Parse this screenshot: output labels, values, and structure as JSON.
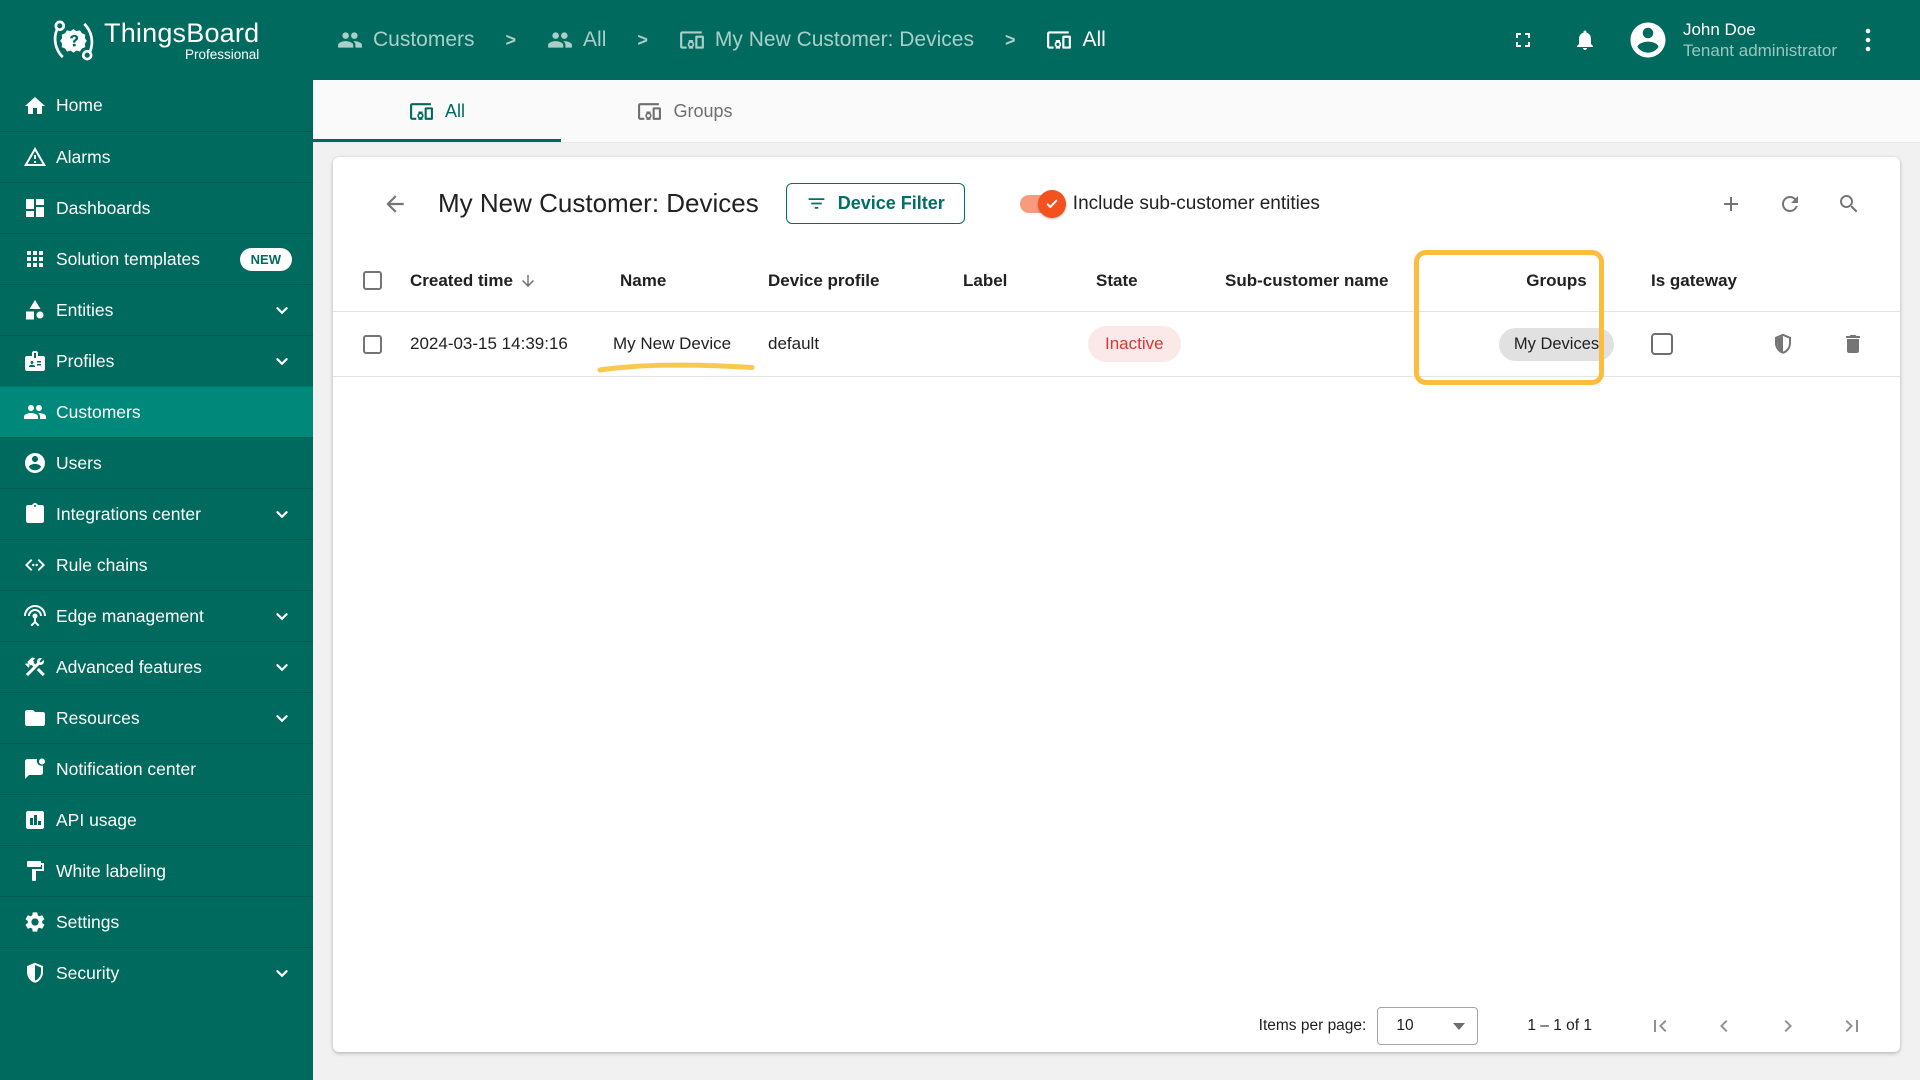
{
  "app": {
    "name": "ThingsBoard",
    "edition": "Professional"
  },
  "header": {
    "breadcrumb": [
      {
        "label": "Customers",
        "icon": "customers-icon"
      },
      {
        "label": "All",
        "icon": "customers-icon"
      },
      {
        "label": "My New Customer: Devices",
        "icon": "devices-icon"
      },
      {
        "label": "All",
        "icon": "devices-icon"
      }
    ],
    "icons": [
      "fullscreen-icon",
      "notifications-bell-icon",
      "avatar",
      "kebab-menu-icon"
    ],
    "user": {
      "name": "John Doe",
      "role": "Tenant administrator"
    }
  },
  "sidebar": {
    "items": [
      {
        "label": "Home",
        "icon": "home-icon"
      },
      {
        "label": "Alarms",
        "icon": "alarm-icon"
      },
      {
        "label": "Dashboards",
        "icon": "dashboards-icon"
      },
      {
        "label": "Solution templates",
        "icon": "solution-templates-icon",
        "badge": "NEW"
      },
      {
        "label": "Entities",
        "icon": "entities-icon",
        "expandable": true
      },
      {
        "label": "Profiles",
        "icon": "profiles-icon",
        "expandable": true
      },
      {
        "label": "Customers",
        "icon": "customers-icon",
        "active": true
      },
      {
        "label": "Users",
        "icon": "users-icon"
      },
      {
        "label": "Integrations center",
        "icon": "integrations-icon",
        "expandable": true
      },
      {
        "label": "Rule chains",
        "icon": "rule-chains-icon"
      },
      {
        "label": "Edge management",
        "icon": "edge-icon",
        "expandable": true
      },
      {
        "label": "Advanced features",
        "icon": "advanced-features-icon",
        "expandable": true
      },
      {
        "label": "Resources",
        "icon": "resources-icon",
        "expandable": true
      },
      {
        "label": "Notification center",
        "icon": "notification-icon"
      },
      {
        "label": "API usage",
        "icon": "api-usage-icon"
      },
      {
        "label": "White labeling",
        "icon": "white-labeling-icon"
      },
      {
        "label": "Settings",
        "icon": "settings-icon"
      },
      {
        "label": "Security",
        "icon": "security-icon",
        "expandable": true
      }
    ]
  },
  "tabs": [
    {
      "label": "All",
      "active": true
    },
    {
      "label": "Groups",
      "active": false
    }
  ],
  "toolbar": {
    "title": "My New Customer: Devices",
    "filter_button": "Device Filter",
    "toggle_label": "Include sub-customer entities",
    "include_sub_customers": true,
    "icons": [
      "add-icon",
      "refresh-icon",
      "search-icon"
    ]
  },
  "table": {
    "columns": [
      "Created time",
      "Name",
      "Device profile",
      "Label",
      "State",
      "Sub-customer name",
      "Groups",
      "Is gateway"
    ],
    "sort": {
      "column": "Created time",
      "direction": "desc"
    },
    "rows": [
      {
        "created_time": "2024-03-15 14:39:16",
        "name": "My New Device",
        "device_profile": "default",
        "label": "",
        "state": "Inactive",
        "sub_customer_name": "",
        "groups": [
          "My Devices"
        ],
        "is_gateway": false,
        "actions": [
          "security-shield-icon",
          "delete-icon"
        ]
      }
    ]
  },
  "annotations": {
    "highlighted_column": "Groups",
    "underlined_cell": "My New Device",
    "highlight_color": "#FBBE3C"
  },
  "footer": {
    "items_per_page_label": "Items per page:",
    "items_per_page_value": "10",
    "range_label": "1 – 1 of 1"
  },
  "colors": {
    "primary_teal": "#016A5E",
    "active_item": "#00897B",
    "toggle_orange": "#F4511E",
    "state_inactive_text": "#D33A32",
    "state_inactive_bg": "#FBE9E9",
    "chip_bg": "#E1E1E1",
    "highlight": "#FBBE3C"
  }
}
